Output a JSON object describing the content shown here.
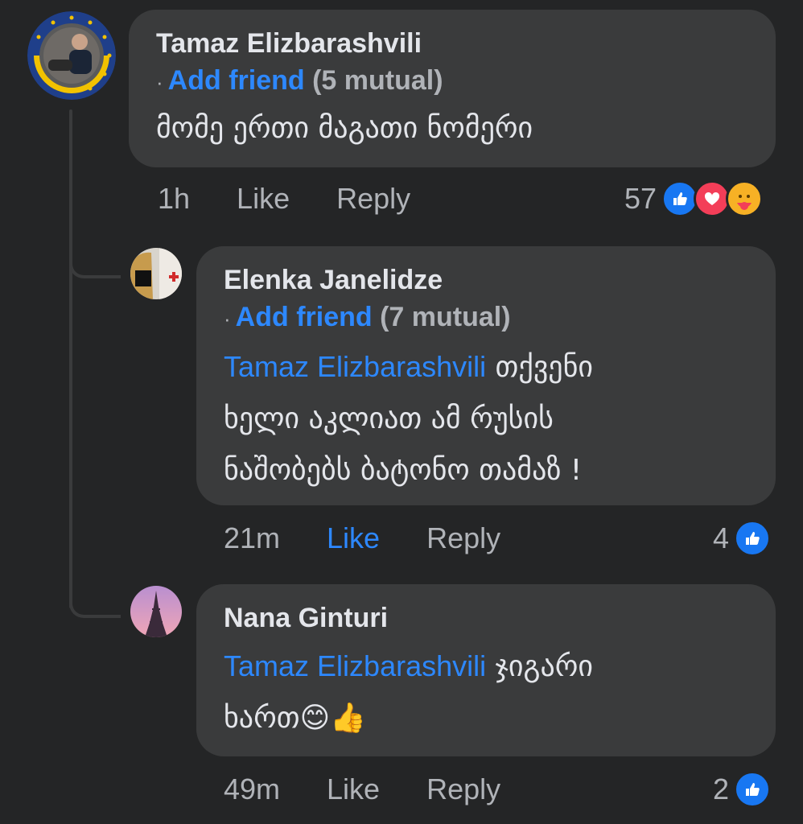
{
  "comments": [
    {
      "author": "Tamaz  Elizbarashvili",
      "add_friend": "Add friend",
      "mutual": "(5 mutual)",
      "mention": "",
      "text": "მომე ერთი მაგათი ნომერი",
      "time": "1h",
      "like": "Like",
      "reply": "Reply",
      "reaction_count": "57"
    },
    {
      "author": "Elenka Janelidze",
      "add_friend": "Add friend",
      "mutual": "(7 mutual)",
      "mention": "Tamaz  Elizbarashvili",
      "text_line1": " თქვენი",
      "text_line2": "ხელი აკლიათ ამ რუსის",
      "text_line3": "ნაშობებს ბატონო თამაზ !",
      "time": "21m",
      "like": "Like",
      "reply": "Reply",
      "reaction_count": "4"
    },
    {
      "author": "Nana Ginturi",
      "mention": "Tamaz  Elizbarashvili",
      "text_line1": " ჯიგარი",
      "text_line2": "ხართ😊👍",
      "time": "49m",
      "like": "Like",
      "reply": "Reply",
      "reaction_count": "2"
    }
  ],
  "colors": {
    "background": "#242526",
    "bubble": "#3a3b3c",
    "link_blue": "#2d88ff",
    "text": "#e4e6eb",
    "muted": "#b0b3b8"
  },
  "icons": [
    "like-reaction-icon",
    "love-reaction-icon",
    "care-reaction-icon"
  ]
}
